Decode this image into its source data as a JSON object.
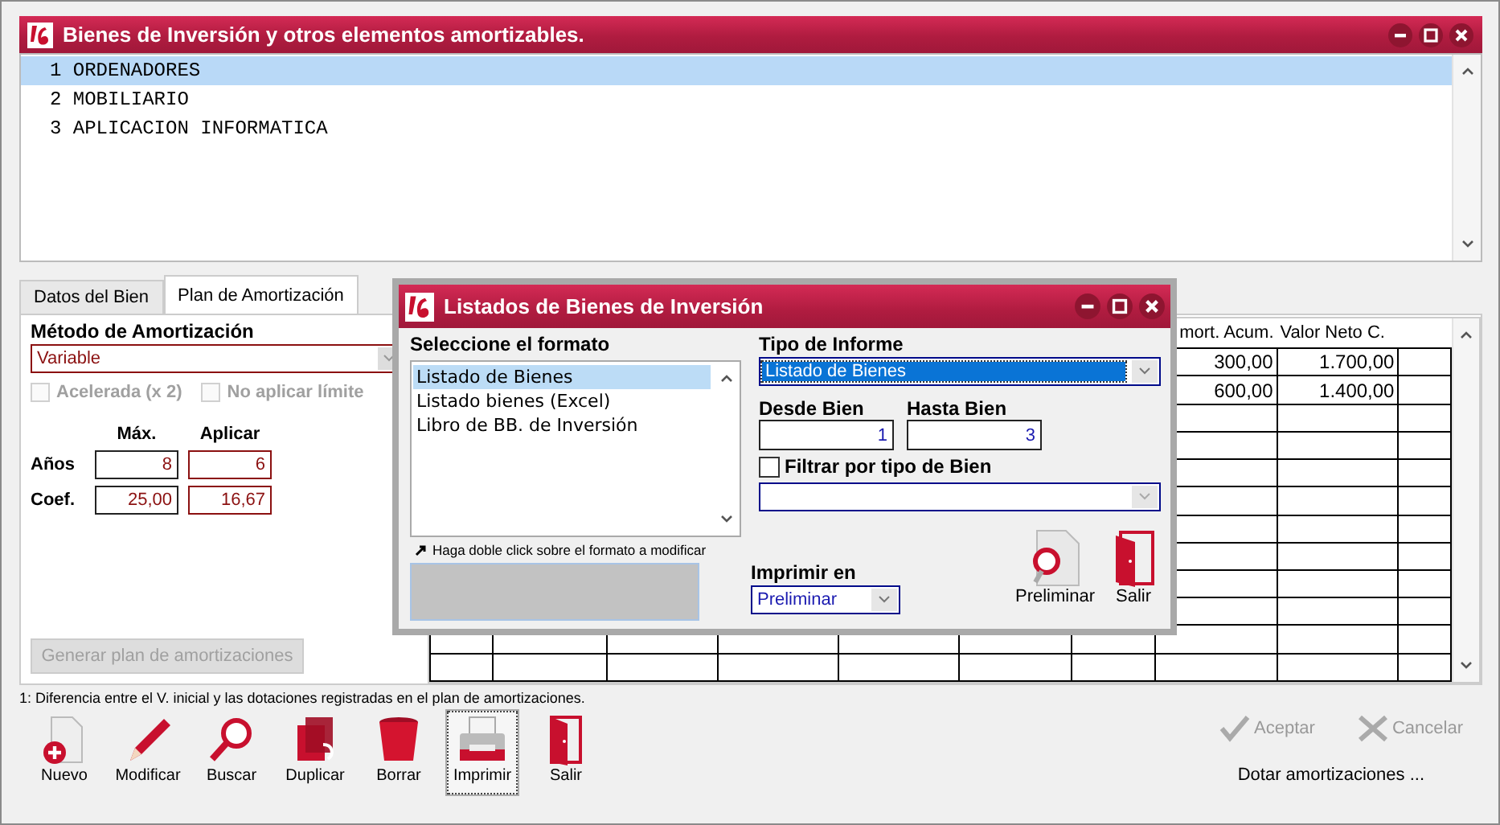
{
  "window": {
    "title": "Bienes de Inversión y otros elementos amortizables."
  },
  "items": [
    {
      "number": "1",
      "name": "ORDENADORES",
      "selected": true
    },
    {
      "number": "2",
      "name": "MOBILIARIO",
      "selected": false
    },
    {
      "number": "3",
      "name": "APLICACION INFORMATICA",
      "selected": false
    }
  ],
  "tabs": [
    {
      "label": "Datos del Bien",
      "selected": false
    },
    {
      "label": "Plan de Amortización",
      "selected": true
    }
  ],
  "plan": {
    "method_label": "Método de Amortización",
    "method": "Variable",
    "options": [
      {
        "label": "Acelerada (x 2)",
        "checked": false,
        "disabled": true
      },
      {
        "label": "No aplicar límite",
        "checked": false,
        "disabled": true
      }
    ],
    "max_header": "Máx.",
    "apply_header": "Aplicar",
    "rows": [
      {
        "label": "Años",
        "max": "8",
        "apply": "6"
      },
      {
        "label": "Coef.",
        "max": "25,00",
        "apply": "16,67"
      }
    ],
    "generate_button": {
      "label": "Generar plan de amortizaciones",
      "disabled": true
    }
  },
  "grid": {
    "columns": [
      "mort. Acum.",
      "Valor Neto C."
    ],
    "rows": [
      {
        "amort": "300,00",
        "net": "1.700,00"
      },
      {
        "amort": "600,00",
        "net": "1.400,00"
      }
    ]
  },
  "dialog": {
    "title": "Listados de Bienes de Inversión",
    "format_label": "Seleccione el formato",
    "formats": [
      {
        "label": "Listado de Bienes",
        "selected": true
      },
      {
        "label": "Listado bienes (Excel)",
        "selected": false
      },
      {
        "label": "Libro de BB. de Inversión",
        "selected": false
      }
    ],
    "hint": "Haga doble click sobre el formato a modificar",
    "report_label": "Tipo de Informe",
    "report_value": "Listado de Bienes",
    "from_label": "Desde Bien",
    "from": "1",
    "to_label": "Hasta Bien",
    "to": "3",
    "filter": {
      "label": "Filtrar por tipo de Bien",
      "checked": false
    },
    "print_label": "Imprimir en",
    "print_value": "Preliminar",
    "buttons": [
      {
        "label": "Preliminar",
        "kind": "preview"
      },
      {
        "label": "Salir",
        "kind": "exit"
      }
    ]
  },
  "footnote": "1: Diferencia entre el V. inicial y las dotaciones registradas en el plan de amortizaciones.",
  "toolbar": [
    {
      "label": "Nuevo",
      "kind": "new",
      "selected": false
    },
    {
      "label": "Modificar",
      "kind": "edit",
      "selected": false
    },
    {
      "label": "Buscar",
      "kind": "search",
      "selected": false
    },
    {
      "label": "Duplicar",
      "kind": "duplicate",
      "selected": false
    },
    {
      "label": "Borrar",
      "kind": "delete",
      "selected": false
    },
    {
      "label": "Imprimir",
      "kind": "print",
      "selected": true
    },
    {
      "label": "Salir",
      "kind": "exit",
      "selected": false
    }
  ],
  "actions": [
    {
      "label": "Aceptar",
      "kind": "accept",
      "disabled": true
    },
    {
      "label": "Cancelar",
      "kind": "cancel",
      "disabled": true
    }
  ],
  "post_link": "Dotar amortizaciones ..."
}
